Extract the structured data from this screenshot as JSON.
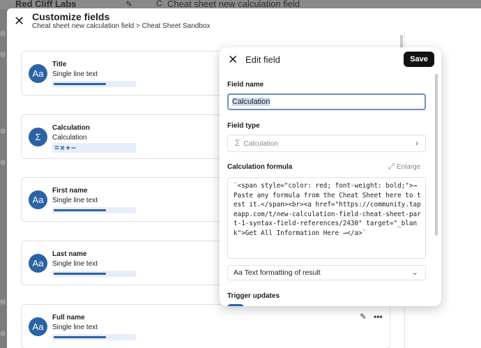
{
  "background": {
    "org_name": "Red Cliff Labs",
    "crumb_letter": "C",
    "crumb_text": "Cheat sheet new calculation field"
  },
  "modal": {
    "title": "Customize fields",
    "subtitle": "Cheat sheet new calculation field > Cheat Sheet Sandbox"
  },
  "fields": [
    {
      "name": "Title",
      "type": "Single line text",
      "avatar": "Aa",
      "kind": "text"
    },
    {
      "name": "Calculation",
      "type": "Calculation",
      "avatar": "Σ",
      "kind": "calc",
      "ops": "=×+−"
    },
    {
      "name": "First name",
      "type": "Single line text",
      "avatar": "Aa",
      "kind": "text"
    },
    {
      "name": "Last name",
      "type": "Single line text",
      "avatar": "Aa",
      "kind": "text"
    },
    {
      "name": "Full name",
      "type": "Single line text",
      "avatar": "Aa",
      "kind": "text"
    }
  ],
  "edit_panel": {
    "title": "Edit field",
    "save_label": "Save",
    "field_name_label": "Field name",
    "field_name_value": "Calculation",
    "field_type_label": "Field type",
    "field_type_value": "Calculation",
    "formula_label": "Calculation formula",
    "enlarge_label": "Enlarge",
    "formula_text": "`<span style=\"color: red; font-weight: bold;\">→ Paste any formula from the Cheat Sheet here to test it.</span><br><a href=\"https://community.tapeapp.com/t/new-calculation-field-cheat-sheet-part-1-syntax-field-references/2430\" target=\"_blank\">Get All Information Here →</a>`",
    "format_icon": "Aa",
    "format_label": "Text formatting of result",
    "trigger_label": "Trigger updates"
  },
  "icons": {
    "close": "close-icon",
    "edit": "pencil-icon",
    "more": "ellipsis-icon",
    "chevron": "chevron-icon",
    "sigma": "sigma-icon",
    "enlarge": "enlarge-icon"
  },
  "colors": {
    "accent": "#2b63a4",
    "save_bg": "#111111"
  }
}
